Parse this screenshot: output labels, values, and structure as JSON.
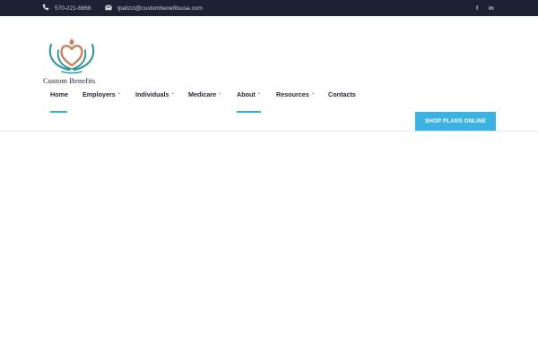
{
  "topbar": {
    "phone": "570-221-6868",
    "email": "tpalizzi@custombenefitsusa.com",
    "social": {
      "facebook": "f",
      "linkedin": "in"
    }
  },
  "brand": {
    "name": "Custom Benefits"
  },
  "nav": {
    "items": [
      {
        "label": "Home",
        "caret": ""
      },
      {
        "label": "Employers",
        "caret": "▾"
      },
      {
        "label": "Individuals",
        "caret": "▾"
      },
      {
        "label": "Medicare",
        "caret": "▾"
      },
      {
        "label": "About",
        "caret": "▾"
      },
      {
        "label": "Resources",
        "caret": "▾"
      },
      {
        "label": "Contacts",
        "caret": ""
      }
    ]
  },
  "cta": {
    "label": "SHOP PLANS ONLINE"
  },
  "colors": {
    "topbar": "#1b2233",
    "accent": "#3bb3e2",
    "heart": "#c9835a",
    "teal": "#3c9a9a"
  }
}
